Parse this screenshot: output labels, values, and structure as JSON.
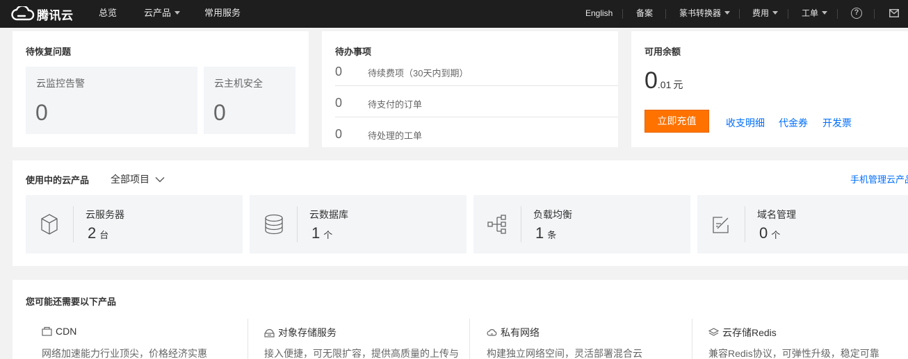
{
  "topbar": {
    "logo_text": "腾讯云",
    "nav": {
      "overview": "总览",
      "products": "云产品",
      "services": "常用服务"
    },
    "right": {
      "english": "English",
      "beian": "备案",
      "converter": "篆书转换器",
      "billing": "费用",
      "ticket": "工单",
      "help_glyph": "?"
    }
  },
  "recovery": {
    "title": "待恢复问题",
    "items": [
      {
        "label": "云监控告警",
        "value": "0"
      },
      {
        "label": "云主机安全",
        "value": "0"
      }
    ]
  },
  "todo": {
    "title": "待办事项",
    "items": [
      {
        "count": "0",
        "label": "待续费项（30天内到期）"
      },
      {
        "count": "0",
        "label": "待支付的订单"
      },
      {
        "count": "0",
        "label": "待处理的工单"
      }
    ]
  },
  "balance": {
    "title": "可用余额",
    "integer": "0",
    "decimal": ".01",
    "unit": "元",
    "recharge_button": "立即充值",
    "links": {
      "details": "收支明细",
      "vouchers": "代金券",
      "invoice": "开发票"
    }
  },
  "in_use": {
    "title": "使用中的云产品",
    "project_filter": "全部项目",
    "mobile_link": "手机管理云产品",
    "products": [
      {
        "name": "云服务器",
        "count": "2",
        "unit": "台",
        "icon": "cube-icon"
      },
      {
        "name": "云数据库",
        "count": "1",
        "unit": "个",
        "icon": "database-icon"
      },
      {
        "name": "负载均衡",
        "count": "1",
        "unit": "条",
        "icon": "load-balancer-icon"
      },
      {
        "name": "域名管理",
        "count": "0",
        "unit": "个",
        "icon": "domain-edit-icon"
      }
    ]
  },
  "recommend": {
    "title": "您可能还需要以下产品",
    "items": [
      {
        "name": "CDN",
        "desc": "网络加速能力行业顶尖，价格经济实惠",
        "icon": "cdn-box-icon"
      },
      {
        "name": "对象存储服务",
        "desc": "接入便捷，可无限扩容，提供高质量的上传与",
        "icon": "storage-icon"
      },
      {
        "name": "私有网络",
        "desc": "构建独立网络空间，灵活部署混合云",
        "icon": "cloud-network-icon"
      },
      {
        "name": "云存储Redis",
        "desc": "兼容Redis协议，可弹性升级，稳定可靠",
        "icon": "layers-icon"
      }
    ]
  },
  "colors": {
    "topbar": "#1e1e1e",
    "accent_orange": "#ff7200",
    "link_blue": "#006eff",
    "page_bg": "#f2f2f2"
  }
}
